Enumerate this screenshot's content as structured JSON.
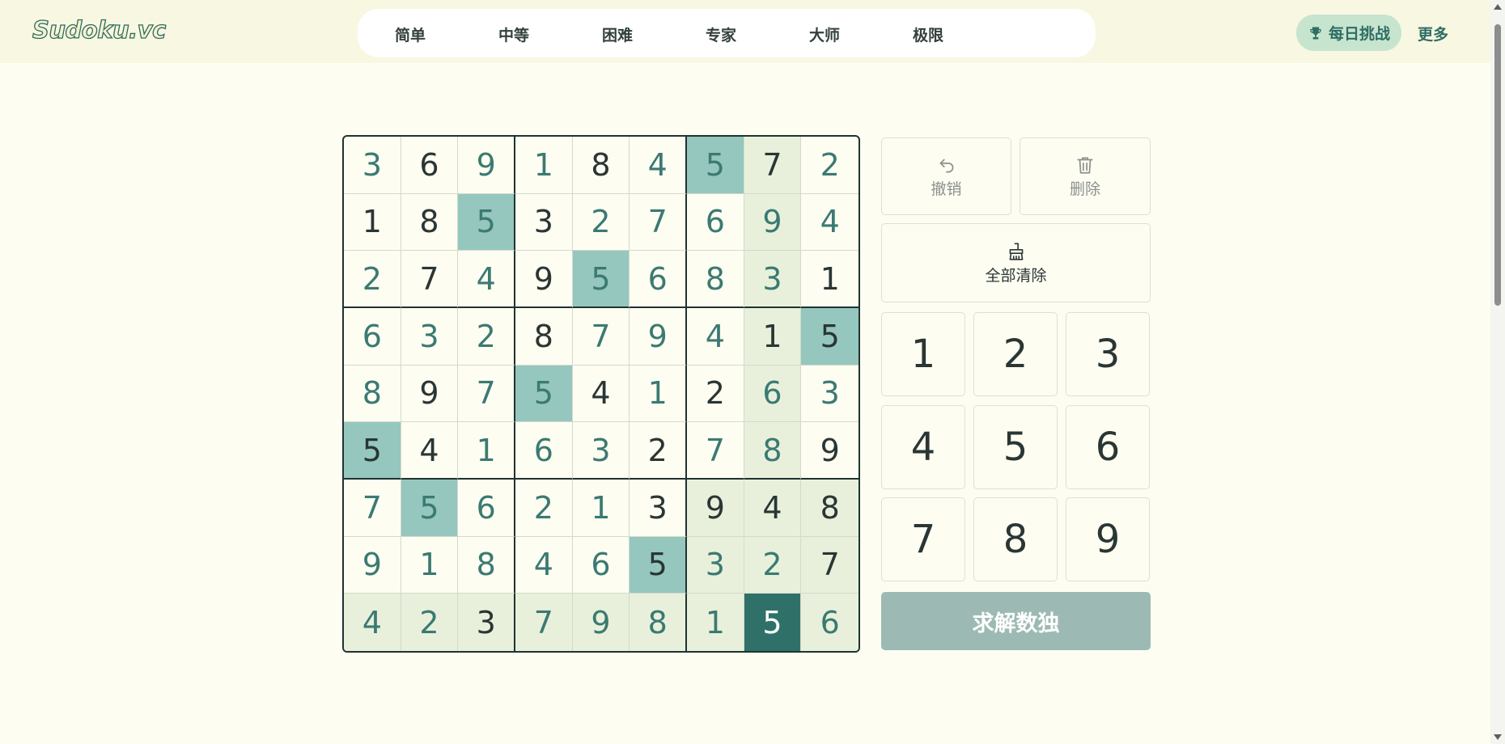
{
  "logo": "Sudoku.vc",
  "nav": [
    "简单",
    "中等",
    "困难",
    "专家",
    "大师",
    "极限"
  ],
  "header": {
    "daily_label": "每日挑战",
    "more_label": "更多"
  },
  "board": {
    "values": [
      [
        3,
        6,
        9,
        1,
        8,
        4,
        5,
        7,
        2
      ],
      [
        1,
        8,
        5,
        3,
        2,
        7,
        6,
        9,
        4
      ],
      [
        2,
        7,
        4,
        9,
        5,
        6,
        8,
        3,
        1
      ],
      [
        6,
        3,
        2,
        8,
        7,
        9,
        4,
        1,
        5
      ],
      [
        8,
        9,
        7,
        5,
        4,
        1,
        2,
        6,
        3
      ],
      [
        5,
        4,
        1,
        6,
        3,
        2,
        7,
        8,
        9
      ],
      [
        7,
        5,
        6,
        2,
        1,
        3,
        9,
        4,
        8
      ],
      [
        9,
        1,
        8,
        4,
        6,
        5,
        3,
        2,
        7
      ],
      [
        4,
        2,
        3,
        7,
        9,
        8,
        1,
        5,
        6
      ]
    ],
    "given": [
      [
        0,
        1,
        0,
        0,
        1,
        0,
        0,
        1,
        0
      ],
      [
        1,
        1,
        0,
        1,
        0,
        0,
        0,
        0,
        0
      ],
      [
        0,
        1,
        0,
        1,
        0,
        0,
        0,
        0,
        1
      ],
      [
        0,
        0,
        0,
        1,
        0,
        0,
        0,
        1,
        1
      ],
      [
        0,
        1,
        0,
        0,
        1,
        0,
        1,
        0,
        0
      ],
      [
        1,
        1,
        0,
        0,
        0,
        1,
        0,
        0,
        1
      ],
      [
        0,
        0,
        0,
        0,
        0,
        1,
        1,
        1,
        1
      ],
      [
        0,
        0,
        0,
        0,
        0,
        1,
        0,
        0,
        1
      ],
      [
        0,
        0,
        1,
        0,
        0,
        0,
        0,
        0,
        0
      ]
    ],
    "selected": [
      8,
      7
    ]
  },
  "tools": {
    "undo_label": "撤销",
    "delete_label": "删除",
    "clear_label": "全部清除"
  },
  "keypad": [
    "1",
    "2",
    "3",
    "4",
    "5",
    "6",
    "7",
    "8",
    "9"
  ],
  "solve_label": "求解数独",
  "colors": {
    "background": "#fefdf2",
    "accent": "#2f7168",
    "same_number": "#95c7be",
    "peer_highlight": "#e8f0dc",
    "solve_button": "#9cbab3"
  },
  "icons": {
    "daily": "trophy-icon",
    "undo": "undo-icon",
    "delete": "trash-icon",
    "clear": "broom-icon"
  }
}
